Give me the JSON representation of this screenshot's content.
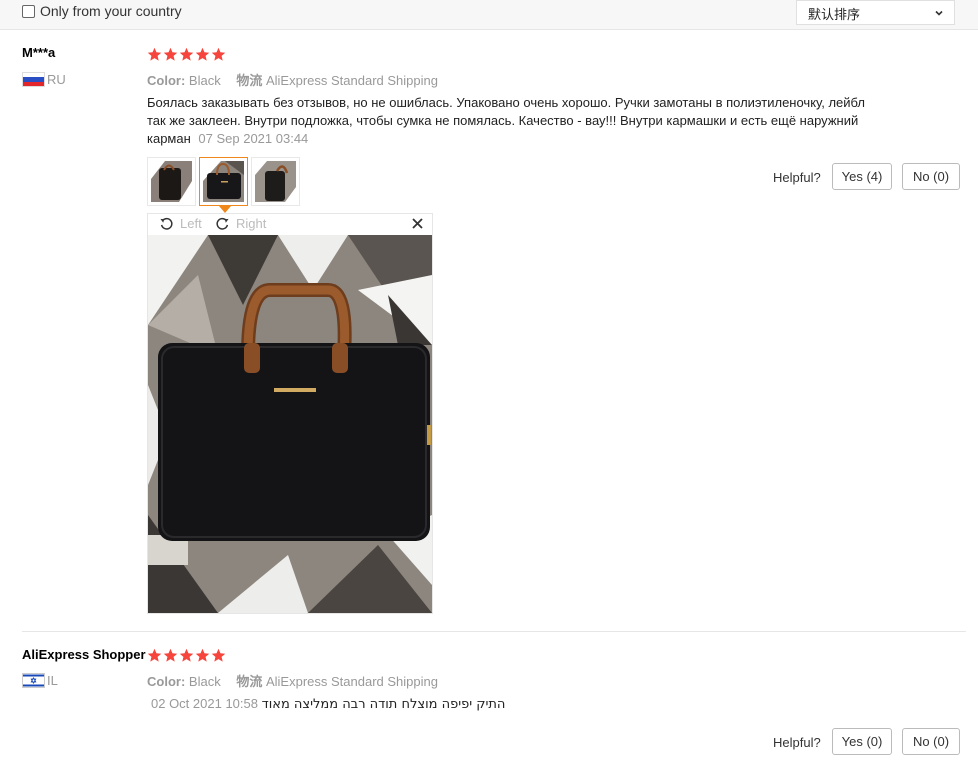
{
  "filter": {
    "country_label": "Only from your country",
    "sort_value": "默认排序"
  },
  "reviews": [
    {
      "user": "M***a",
      "country": "RU",
      "flag": "russia-flag",
      "stars": 5,
      "color_key": "Color:",
      "color_value": "Black",
      "shipping_key": "物流",
      "shipping_value": "AliExpress Standard Shipping",
      "text": "Боялась заказывать без отзывов, но не ошиблась. Упаковано очень хорошо. Ручки замотаны в полиэтиленочку, лейбл так же заклеен. Внутри подложка, чтобы сумка не помялась. Качество - вау!!! Внутри кармашки и есть ещё наружний карман",
      "date": "07 Sep 2021 03:44",
      "photos": 3,
      "active_photo": 2,
      "helpful_label": "Helpful?",
      "yes_label": "Yes (4)",
      "no_label": "No (0)"
    },
    {
      "user": "AliExpress Shopper",
      "country": "IL",
      "flag": "israel-flag",
      "stars": 5,
      "color_key": "Color:",
      "color_value": "Black",
      "shipping_key": "物流",
      "shipping_value": "AliExpress Standard Shipping",
      "text": "התיק יפיפה מוצלח תודה רבה ממליצה מאוד",
      "date": "02 Oct 2021 10:58",
      "helpful_label": "Helpful?",
      "yes_label": "Yes (0)",
      "no_label": "No (0)"
    }
  ],
  "viewer": {
    "rotate_left_label": "Left",
    "rotate_right_label": "Right"
  },
  "colors": {
    "star": "#f5453d",
    "accent": "#f0871a",
    "muted": "#999999"
  }
}
